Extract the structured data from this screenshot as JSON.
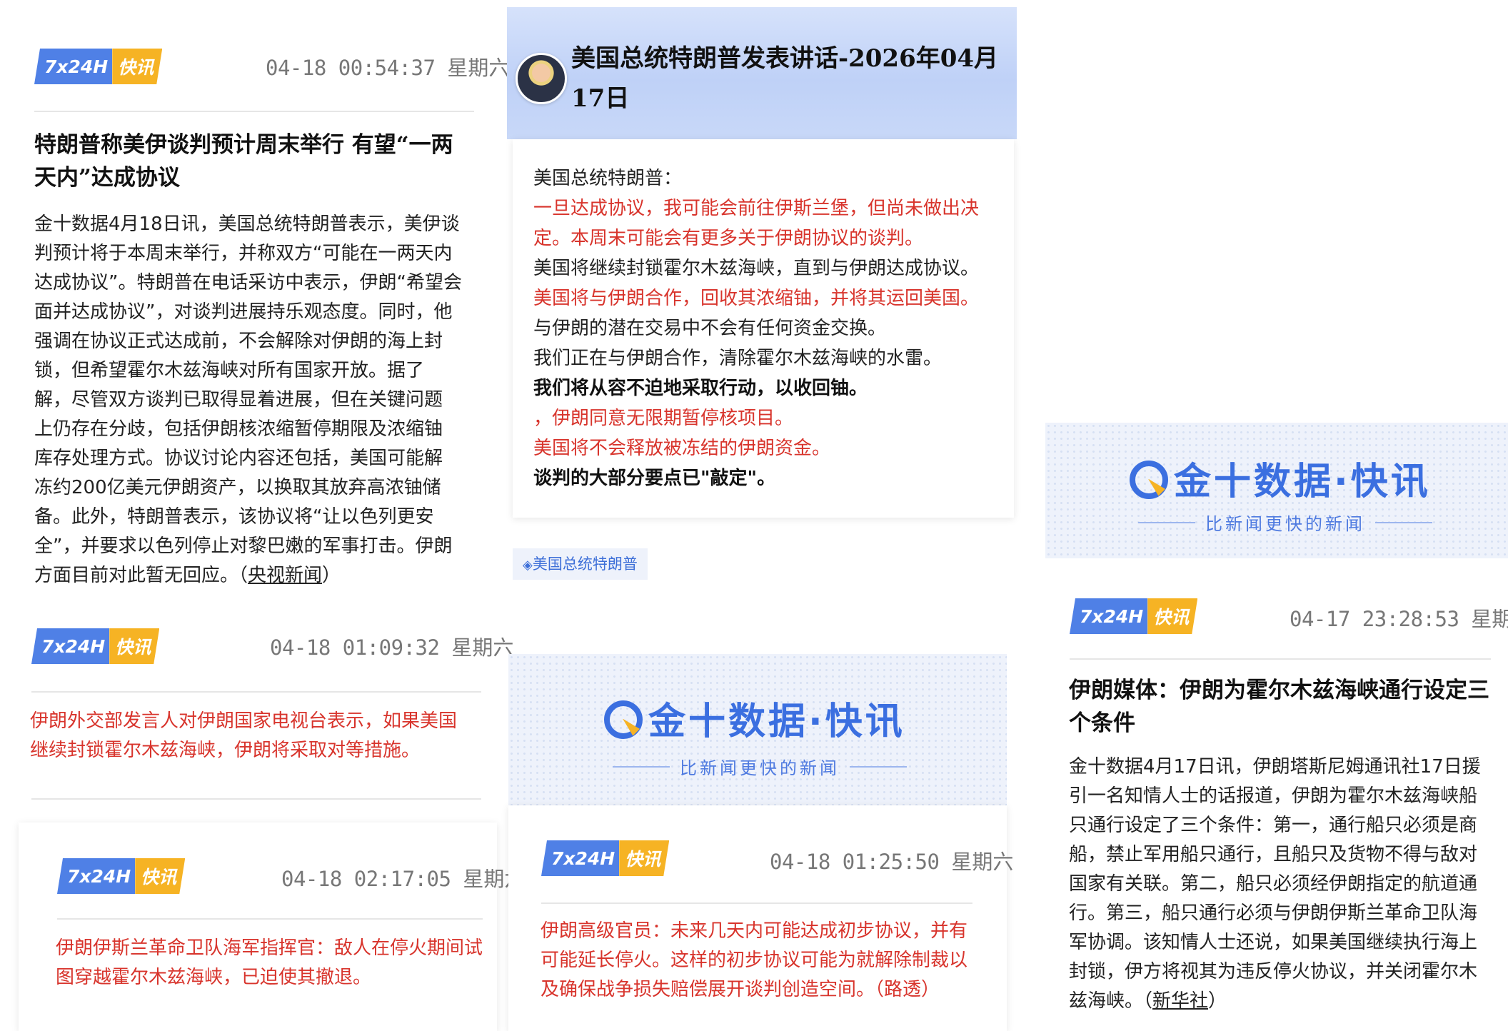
{
  "badge": {
    "left": "7x24H",
    "right": "快讯"
  },
  "news1": {
    "time": "04-18 00:54:37",
    "weekday": "星期六",
    "title_l1": "特朗普称美伊谈判预计周末举行 有望“一两",
    "title_l2": "天内”达成协议",
    "lines": [
      "金十数据4月18日讯，美国总统特朗普表示，美伊谈",
      "判预计将于本周末举行，并称双方“可能在一两天内",
      "达成协议”。特朗普在电话采访中表示，伊朗“希望会",
      "面并达成协议”，对谈判进展持乐观态度。同时，他",
      "强调在协议正式达成前，不会解除对伊朗的海上封",
      "锁，但希望霍尔木兹海峡对所有国家开放。据了",
      "解，尽管双方谈判已取得显着进展，但在关键问题",
      "上仍存在分歧，包括伊朗核浓缩暂停期限及浓缩铀",
      "库存处理方式。协议讨论内容还包括，美国可能解",
      "冻约200亿美元伊朗资产，以换取其放弃高浓铀储",
      "备。此外，特朗普表示，该协议将“让以色列更安",
      "全”，并要求以色列停止对黎巴嫩的军事打击。伊朗"
    ],
    "last_line_prefix": "方面目前对此暂无回应。（",
    "source": "央视新闻",
    "last_line_suffix": "）"
  },
  "news2": {
    "time": "04-18 01:09:32",
    "weekday": "星期六",
    "lines": [
      "伊朗外交部发言人对伊朗国家电视台表示，如果美国",
      "继续封锁霍尔木兹海峡，伊朗将采取对等措施。"
    ]
  },
  "news3": {
    "time": "04-18 02:17:05",
    "weekday": "星期六",
    "lines": [
      "伊朗伊斯兰革命卫队海军指挥官：敌人在停火期间试",
      "图穿越霍尔木兹海峡，已迫使其撤退。"
    ]
  },
  "speech": {
    "title_l1": "美国总统特朗普发表讲话-2026年04月",
    "title_l2": "17日",
    "lines": [
      {
        "text": "美国总统特朗普：",
        "style": "black"
      },
      {
        "text": "一旦达成协议，我可能会前往伊斯兰堡，但尚未做出决",
        "style": "red"
      },
      {
        "text": "定。本周末可能会有更多关于伊朗协议的谈判。",
        "style": "red"
      },
      {
        "text": "美国将继续封锁霍尔木兹海峡，直到与伊朗达成协议。",
        "style": "black"
      },
      {
        "text": "美国将与伊朗合作，回收其浓缩铀，并将其运回美国。",
        "style": "red"
      },
      {
        "text": "与伊朗的潜在交易中不会有任何资金交换。",
        "style": "black"
      },
      {
        "text": "我们正在与伊朗合作，清除霍尔木兹海峡的水雷。",
        "style": "black"
      },
      {
        "text": "我们将从容不迫地采取行动，以收回铀。",
        "style": "bold"
      },
      {
        "text": "，伊朗同意无限期暂停核项目。",
        "style": "red"
      },
      {
        "text": "美国将不会释放被冻结的伊朗资金。",
        "style": "red"
      },
      {
        "text": "谈判的大部分要点已\"敲定\"。",
        "style": "bold"
      }
    ],
    "tag": "美国总统特朗普"
  },
  "banner": {
    "name": "金十数据·快讯",
    "slogan": "比新闻更快的新闻"
  },
  "news4": {
    "time": "04-18 01:25:50",
    "weekday": "星期六",
    "lines": [
      "伊朗高级官员：未来几天内可能达成初步协议，并有",
      "可能延长停火。这样的初步协议可能为就解除制裁以",
      "及确保战争损失赔偿展开谈判创造空间。（路透）"
    ]
  },
  "news5": {
    "time": "04-17 23:28:53",
    "weekday": "星期五",
    "title_l1": "伊朗媒体：伊朗为霍尔木兹海峡通行设定三",
    "title_l2": "个条件",
    "lines": [
      "金十数据4月17日讯，伊朗塔斯尼姆通讯社17日援",
      "引一名知情人士的话报道，伊朗为霍尔木兹海峡船",
      "只通行设定了三个条件：第一，通行船只必须是商",
      "船，禁止军用船只通行，且船只及货物不得与敌对",
      "国家有关联。第二，船只必须经伊朗指定的航道通",
      "行。第三，船只通行必须与伊朗伊斯兰革命卫队海",
      "军协调。该知情人士还说，如果美国继续执行海上",
      "封锁，伊方将视其为违反停火协议，并关闭霍尔木"
    ],
    "last_line_prefix": "兹海峡。（",
    "source": "新华社",
    "last_line_suffix": "）"
  }
}
